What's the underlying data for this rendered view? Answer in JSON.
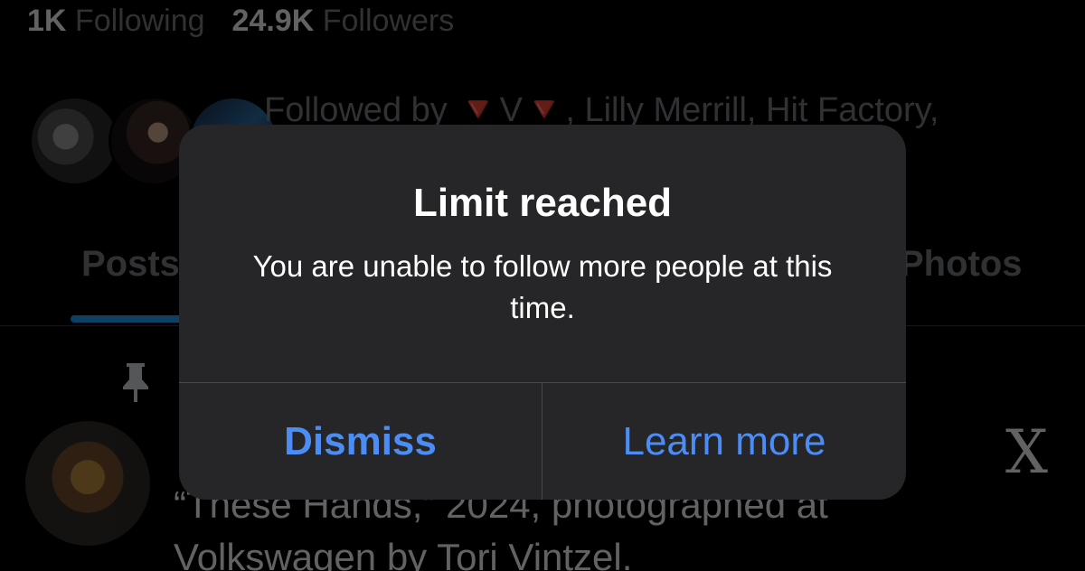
{
  "profile": {
    "following_count": "1K",
    "following_label": "Following",
    "followers_count": "24.9K",
    "followers_label": "Followers",
    "followed_by_prefix": "Followed by",
    "followed_by_tri": "🔻",
    "followed_by_name1": "V",
    "followed_by_rest": ", Lilly Merrill, Hit Factory,"
  },
  "tabs": {
    "posts": "Posts",
    "photos": "Photos"
  },
  "tweet": {
    "text_line1": "“These Hands,” 2024, photographed at",
    "text_line2": "Volkswagen by Tori Vintzel."
  },
  "dialog": {
    "title": "Limit reached",
    "message": "You are unable to follow more people at this time.",
    "dismiss_label": "Dismiss",
    "learn_more_label": "Learn more"
  },
  "colors": {
    "accent_blue": "#4c8df5",
    "tab_underline": "#1d9bf0",
    "dialog_background": "#262628"
  }
}
